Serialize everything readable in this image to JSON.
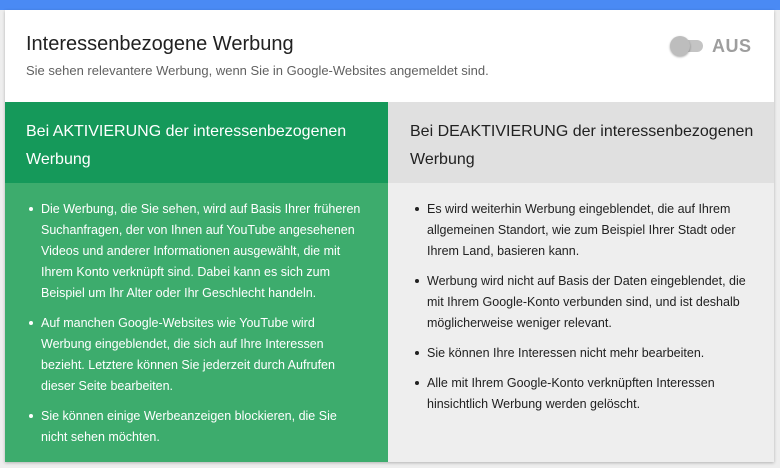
{
  "header": {
    "title": "Interessenbezogene Werbung",
    "subtitle": "Sie sehen relevantere Werbung, wenn Sie in Google-Websites angemeldet sind.",
    "toggle_label": "AUS",
    "toggle_on": false
  },
  "left": {
    "heading": "Bei AKTIVIERUNG der interessenbezogenen Werbung",
    "items": [
      "Die Werbung, die Sie sehen, wird auf Basis Ihrer früheren Suchanfragen, der von Ihnen auf YouTube angesehenen Videos und anderer Informationen ausgewählt, die mit Ihrem Konto verknüpft sind. Dabei kann es sich zum Beispiel um Ihr Alter oder Ihr Geschlecht handeln.",
      "Auf manchen Google-Websites wie YouTube wird Werbung eingeblendet, die sich auf Ihre Interessen bezieht. Letztere können Sie jederzeit durch Aufrufen dieser Seite bearbeiten.",
      "Sie können einige Werbeanzeigen blockieren, die Sie nicht sehen möchten."
    ]
  },
  "right": {
    "heading": "Bei DEAKTIVIERUNG der interessenbezogenen Werbung",
    "items": [
      "Es wird weiterhin Werbung eingeblendet, die auf Ihrem allgemeinen Standort, wie zum Beispiel Ihrer Stadt oder Ihrem Land, basieren kann.",
      "Werbung wird nicht auf Basis der Daten eingeblendet, die mit Ihrem Google-Konto verbunden sind, und ist deshalb möglicherweise weniger relevant.",
      "Sie können Ihre Interessen nicht mehr bearbeiten.",
      "Alle mit Ihrem Google-Konto verknüpften Interessen hinsichtlich Werbung werden gelöscht."
    ]
  },
  "colors": {
    "accent_blue": "#4a8af4",
    "on_header_green": "#15995a",
    "on_body_green": "#3dac6d",
    "off_header_gray": "#e0e0e0",
    "off_body_gray": "#eeeeee"
  }
}
